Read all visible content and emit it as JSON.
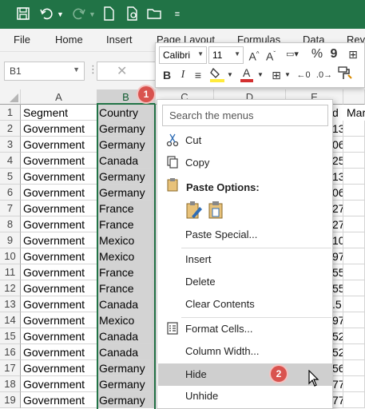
{
  "namebox": {
    "value": "B1"
  },
  "ribbon_tabs": [
    "File",
    "Home",
    "Insert",
    "Page Layout",
    "Formulas",
    "Data",
    "Rev"
  ],
  "column_headers": [
    "A",
    "B",
    "C",
    "D",
    "E"
  ],
  "right_header_text": "d",
  "right_column_text": "Mar",
  "row_numbers": [
    "1",
    "2",
    "3",
    "4",
    "5",
    "6",
    "7",
    "8",
    "9",
    "10",
    "11",
    "12",
    "13",
    "14",
    "15",
    "16",
    "17",
    "18",
    "19"
  ],
  "rows": [
    {
      "segment": "Segment",
      "country": "Country",
      "e": ""
    },
    {
      "segment": "Government",
      "country": "Germany",
      "e": "13"
    },
    {
      "segment": "Government",
      "country": "Germany",
      "e": "06"
    },
    {
      "segment": "Government",
      "country": "Canada",
      "e": "25"
    },
    {
      "segment": "Government",
      "country": "Germany",
      "e": "13"
    },
    {
      "segment": "Government",
      "country": "Germany",
      "e": "06"
    },
    {
      "segment": "Government",
      "country": "France",
      "e": "27"
    },
    {
      "segment": "Government",
      "country": "France",
      "e": "27"
    },
    {
      "segment": "Government",
      "country": "Mexico",
      "e": "10"
    },
    {
      "segment": "Government",
      "country": "Mexico",
      "e": "97"
    },
    {
      "segment": "Government",
      "country": "France",
      "e": "55"
    },
    {
      "segment": "Government",
      "country": "France",
      "e": "55"
    },
    {
      "segment": "Government",
      "country": "Canada",
      "e": ".5"
    },
    {
      "segment": "Government",
      "country": "Mexico",
      "e": "97"
    },
    {
      "segment": "Government",
      "country": "Canada",
      "e": "52"
    },
    {
      "segment": "Government",
      "country": "Canada",
      "e": "52"
    },
    {
      "segment": "Government",
      "country": "Germany",
      "e": "56"
    },
    {
      "segment": "Government",
      "country": "Germany",
      "e": "77"
    },
    {
      "segment": "Government",
      "country": "Germany",
      "e": "77"
    }
  ],
  "mini_toolbar": {
    "font_name": "Calibri",
    "font_size": "11"
  },
  "context_menu": {
    "search_placeholder": "Search the menus",
    "items": {
      "cut": "Cut",
      "copy": "Copy",
      "paste_options": "Paste Options:",
      "paste_special": "Paste Special...",
      "insert": "Insert",
      "delete": "Delete",
      "clear_contents": "Clear Contents",
      "format_cells": "Format Cells...",
      "column_width": "Column Width...",
      "hide": "Hide",
      "unhide": "Unhide"
    }
  },
  "badges": {
    "step1": "1",
    "step2": "2"
  },
  "colors": {
    "excel_green": "#217346",
    "badge_red": "#d9534f",
    "selection_gray": "#d3d3d3"
  }
}
